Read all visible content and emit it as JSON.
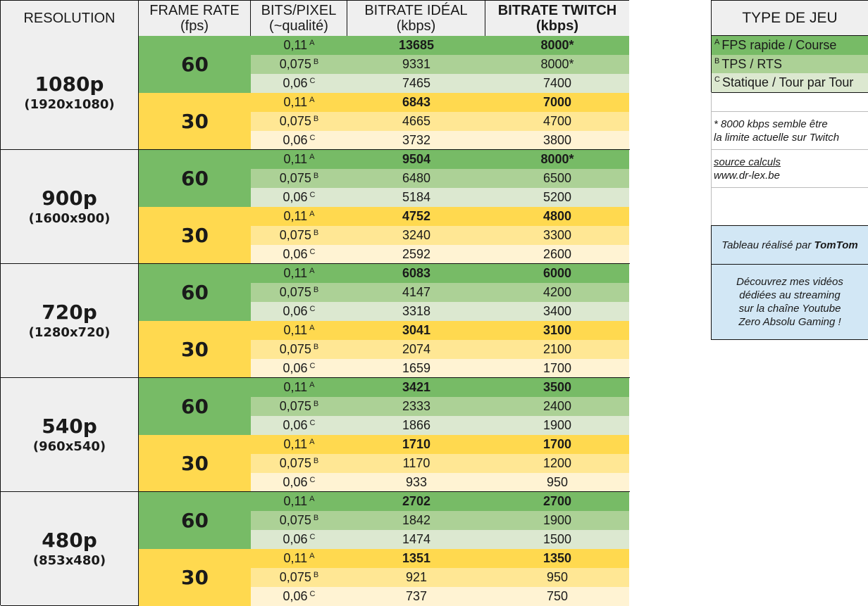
{
  "headers": {
    "resolution": "RESOLUTION",
    "frame_rate": "FRAME RATE",
    "frame_rate_unit": "(fps)",
    "bits_pixel": "BITS/PIXEL",
    "bits_pixel_unit": "(~qualité)",
    "bitrate_ideal": "BITRATE IDÉAL",
    "bitrate_ideal_unit": "(kbps)",
    "bitrate_twitch": "BITRATE TWITCH",
    "bitrate_twitch_unit": "(kbps)"
  },
  "colors": {
    "green_60": "#77bb66",
    "green_b": "#acd196",
    "green_c": "#dce8d0",
    "yellow_30": "#ffd94f",
    "yellow_b": "#ffe794",
    "yellow_c": "#fff3d3",
    "header_bg": "#efefef",
    "info_blue": "#d2e7f5"
  },
  "blocks": [
    {
      "name": "1080p",
      "dims": "(1920x1080)",
      "fps": [
        {
          "fps": "60",
          "rows": [
            {
              "bpp": "0,11",
              "tag": "A",
              "ideal": "13685",
              "twitch": "8000*"
            },
            {
              "bpp": "0,075",
              "tag": "B",
              "ideal": "9331",
              "twitch": "8000*"
            },
            {
              "bpp": "0,06",
              "tag": "C",
              "ideal": "7465",
              "twitch": "7400"
            }
          ]
        },
        {
          "fps": "30",
          "rows": [
            {
              "bpp": "0,11",
              "tag": "A",
              "ideal": "6843",
              "twitch": "7000"
            },
            {
              "bpp": "0,075",
              "tag": "B",
              "ideal": "4665",
              "twitch": "4700"
            },
            {
              "bpp": "0,06",
              "tag": "C",
              "ideal": "3732",
              "twitch": "3800"
            }
          ]
        }
      ]
    },
    {
      "name": "900p",
      "dims": "(1600x900)",
      "fps": [
        {
          "fps": "60",
          "rows": [
            {
              "bpp": "0,11",
              "tag": "A",
              "ideal": "9504",
              "twitch": "8000*"
            },
            {
              "bpp": "0,075",
              "tag": "B",
              "ideal": "6480",
              "twitch": "6500"
            },
            {
              "bpp": "0,06",
              "tag": "C",
              "ideal": "5184",
              "twitch": "5200"
            }
          ]
        },
        {
          "fps": "30",
          "rows": [
            {
              "bpp": "0,11",
              "tag": "A",
              "ideal": "4752",
              "twitch": "4800"
            },
            {
              "bpp": "0,075",
              "tag": "B",
              "ideal": "3240",
              "twitch": "3300"
            },
            {
              "bpp": "0,06",
              "tag": "C",
              "ideal": "2592",
              "twitch": "2600"
            }
          ]
        }
      ]
    },
    {
      "name": "720p",
      "dims": "(1280x720)",
      "fps": [
        {
          "fps": "60",
          "rows": [
            {
              "bpp": "0,11",
              "tag": "A",
              "ideal": "6083",
              "twitch": "6000"
            },
            {
              "bpp": "0,075",
              "tag": "B",
              "ideal": "4147",
              "twitch": "4200"
            },
            {
              "bpp": "0,06",
              "tag": "C",
              "ideal": "3318",
              "twitch": "3400"
            }
          ]
        },
        {
          "fps": "30",
          "rows": [
            {
              "bpp": "0,11",
              "tag": "A",
              "ideal": "3041",
              "twitch": "3100"
            },
            {
              "bpp": "0,075",
              "tag": "B",
              "ideal": "2074",
              "twitch": "2100"
            },
            {
              "bpp": "0,06",
              "tag": "C",
              "ideal": "1659",
              "twitch": "1700"
            }
          ]
        }
      ]
    },
    {
      "name": "540p",
      "dims": "(960x540)",
      "fps": [
        {
          "fps": "60",
          "rows": [
            {
              "bpp": "0,11",
              "tag": "A",
              "ideal": "3421",
              "twitch": "3500"
            },
            {
              "bpp": "0,075",
              "tag": "B",
              "ideal": "2333",
              "twitch": "2400"
            },
            {
              "bpp": "0,06",
              "tag": "C",
              "ideal": "1866",
              "twitch": "1900"
            }
          ]
        },
        {
          "fps": "30",
          "rows": [
            {
              "bpp": "0,11",
              "tag": "A",
              "ideal": "1710",
              "twitch": "1700"
            },
            {
              "bpp": "0,075",
              "tag": "B",
              "ideal": "1170",
              "twitch": "1200"
            },
            {
              "bpp": "0,06",
              "tag": "C",
              "ideal": "933",
              "twitch": "950"
            }
          ]
        }
      ]
    },
    {
      "name": "480p",
      "dims": "(853x480)",
      "fps": [
        {
          "fps": "60",
          "rows": [
            {
              "bpp": "0,11",
              "tag": "A",
              "ideal": "2702",
              "twitch": "2700"
            },
            {
              "bpp": "0,075",
              "tag": "B",
              "ideal": "1842",
              "twitch": "1900"
            },
            {
              "bpp": "0,06",
              "tag": "C",
              "ideal": "1474",
              "twitch": "1500"
            }
          ]
        },
        {
          "fps": "30",
          "rows": [
            {
              "bpp": "0,11",
              "tag": "A",
              "ideal": "1351",
              "twitch": "1350"
            },
            {
              "bpp": "0,075",
              "tag": "B",
              "ideal": "921",
              "twitch": "950"
            },
            {
              "bpp": "0,06",
              "tag": "C",
              "ideal": "737",
              "twitch": "750"
            }
          ]
        }
      ]
    }
  ],
  "side": {
    "title": "TYPE DE JEU",
    "legend": [
      {
        "tag": "A",
        "label": "FPS rapide / Course"
      },
      {
        "tag": "B",
        "label": "TPS / RTS"
      },
      {
        "tag": "C",
        "label": "Statique / Tour par Tour"
      }
    ],
    "note_line1": "* 8000 kbps semble être",
    "note_line2": "la limite actuelle sur Twitch",
    "source_label": "source calculs",
    "source_site": "www.dr-lex.be",
    "credit_prefix": "Tableau réalisé par",
    "credit_author": "TomTom",
    "promo_lines": [
      "Découvrez mes vidéos",
      "dédiées au streaming",
      "sur la chaîne Youtube",
      "Zero Absolu Gaming !"
    ]
  }
}
